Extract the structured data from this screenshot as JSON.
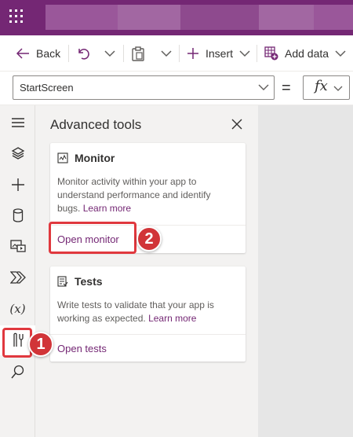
{
  "toolbar": {
    "back_label": "Back",
    "insert_label": "Insert",
    "add_data_label": "Add data"
  },
  "formula_bar": {
    "property_value": "StartScreen",
    "equals": "=",
    "fx_label": "fx"
  },
  "advanced_tools": {
    "title": "Advanced tools",
    "monitor_card": {
      "title": "Monitor",
      "description": "Monitor activity within your app to understand performance and identify bugs.",
      "learn_more": "Learn more",
      "action": "Open monitor"
    },
    "tests_card": {
      "title": "Tests",
      "description": "Write tests to validate that your app is working as expected.",
      "learn_more": "Learn more",
      "action": "Open tests"
    }
  },
  "callouts": {
    "one": "1",
    "two": "2"
  },
  "rail_icons": [
    "hamburger-icon",
    "layers-icon",
    "plus-icon",
    "database-icon",
    "media-icon",
    "power-automate-icon",
    "variables-icon",
    "advanced-tools-icon",
    "search-icon"
  ],
  "variables_glyph": "(x)",
  "colors": {
    "brand_purple": "#742774",
    "callout_red": "#d13438",
    "highlight_red": "#e0383e"
  }
}
